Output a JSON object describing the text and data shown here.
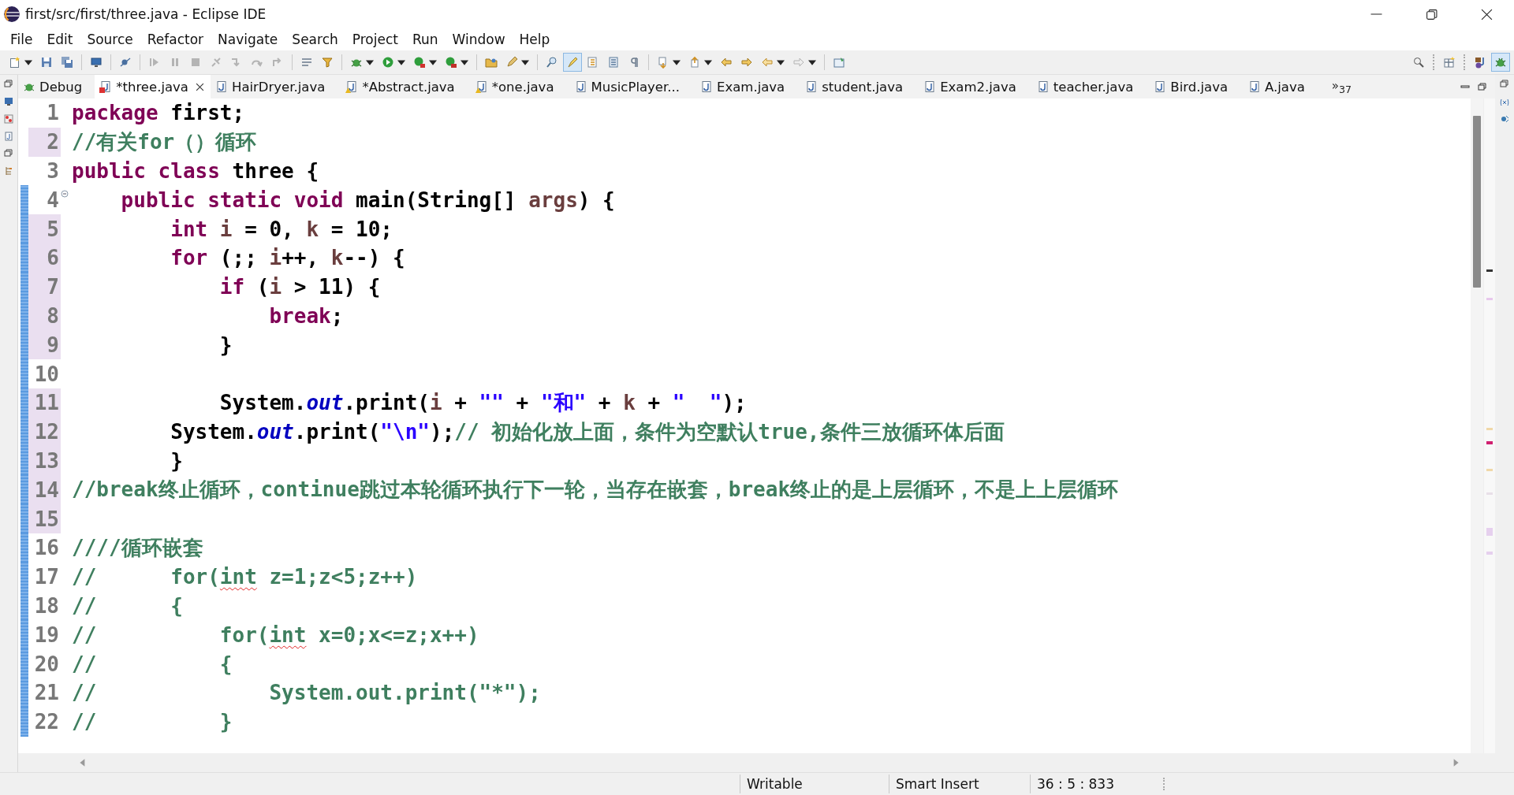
{
  "window": {
    "title": "first/src/first/three.java - Eclipse IDE"
  },
  "menu": [
    "File",
    "Edit",
    "Source",
    "Refactor",
    "Navigate",
    "Search",
    "Project",
    "Run",
    "Window",
    "Help"
  ],
  "perspective_tab": {
    "label": "Debug"
  },
  "tabs": [
    {
      "label": "*three.java",
      "selected": true,
      "error": true,
      "warning": false
    },
    {
      "label": "HairDryer.java",
      "selected": false,
      "error": false,
      "warning": false
    },
    {
      "label": "*Abstract.java",
      "selected": false,
      "error": false,
      "warning": true
    },
    {
      "label": "*one.java",
      "selected": false,
      "error": false,
      "warning": true
    },
    {
      "label": "MusicPlayer...",
      "selected": false,
      "error": false,
      "warning": false
    },
    {
      "label": "Exam.java",
      "selected": false,
      "error": false,
      "warning": false
    },
    {
      "label": "student.java",
      "selected": false,
      "error": false,
      "warning": false
    },
    {
      "label": "Exam2.java",
      "selected": false,
      "error": false,
      "warning": false
    },
    {
      "label": "teacher.java",
      "selected": false,
      "error": false,
      "warning": false
    },
    {
      "label": "Bird.java",
      "selected": false,
      "error": false,
      "warning": false
    },
    {
      "label": "A.java",
      "selected": false,
      "error": false,
      "warning": false
    }
  ],
  "tab_overflow": "»$_{37}$",
  "code_lines": [
    {
      "n": "1",
      "changed": false,
      "range": false,
      "fold": false,
      "tokens": [
        {
          "t": "package",
          "kind": "keyword"
        },
        {
          "t": " first;",
          "kind": "plain"
        }
      ]
    },
    {
      "n": "2",
      "changed": true,
      "range": false,
      "fold": false,
      "tokens": [
        {
          "t": "//有关for（）循环",
          "kind": "comment"
        }
      ]
    },
    {
      "n": "3",
      "changed": false,
      "range": false,
      "fold": false,
      "tokens": [
        {
          "t": "public class",
          "kind": "keyword"
        },
        {
          "t": " three {",
          "kind": "plain"
        }
      ]
    },
    {
      "n": "4",
      "changed": false,
      "range": true,
      "fold": true,
      "tokens": [
        {
          "t": "    public static void",
          "kind": "keyword"
        },
        {
          "t": " main(String[] ",
          "kind": "plain"
        },
        {
          "t": "args",
          "kind": "variable"
        },
        {
          "t": ") {",
          "kind": "plain"
        }
      ]
    },
    {
      "n": "5",
      "changed": true,
      "range": true,
      "fold": false,
      "tokens": [
        {
          "t": "        int ",
          "kind": "keyword"
        },
        {
          "t": "i",
          "kind": "variable"
        },
        {
          "t": " = 0, ",
          "kind": "plain"
        },
        {
          "t": "k",
          "kind": "variable"
        },
        {
          "t": " = 10;",
          "kind": "plain"
        }
      ]
    },
    {
      "n": "6",
      "changed": true,
      "range": true,
      "fold": false,
      "tokens": [
        {
          "t": "        for",
          "kind": "keyword"
        },
        {
          "t": " (;; ",
          "kind": "plain"
        },
        {
          "t": "i",
          "kind": "variable"
        },
        {
          "t": "++, ",
          "kind": "plain"
        },
        {
          "t": "k",
          "kind": "variable"
        },
        {
          "t": "--) {",
          "kind": "plain"
        }
      ]
    },
    {
      "n": "7",
      "changed": true,
      "range": true,
      "fold": false,
      "tokens": [
        {
          "t": "            if",
          "kind": "keyword"
        },
        {
          "t": " (",
          "kind": "plain"
        },
        {
          "t": "i",
          "kind": "variable"
        },
        {
          "t": " > 11) {",
          "kind": "plain"
        }
      ]
    },
    {
      "n": "8",
      "changed": true,
      "range": true,
      "fold": false,
      "tokens": [
        {
          "t": "                break",
          "kind": "keyword"
        },
        {
          "t": ";",
          "kind": "plain"
        }
      ]
    },
    {
      "n": "9",
      "changed": true,
      "range": true,
      "fold": false,
      "tokens": [
        {
          "t": "            }",
          "kind": "plain"
        }
      ]
    },
    {
      "n": "10",
      "changed": false,
      "range": true,
      "fold": false
    },
    {
      "n": "11",
      "changed": true,
      "range": true,
      "fold": false,
      "tokens": [
        {
          "t": "            System.",
          "kind": "plain"
        },
        {
          "t": "out",
          "kind": "field"
        },
        {
          "t": ".print(",
          "kind": "plain"
        },
        {
          "t": "i",
          "kind": "variable"
        },
        {
          "t": " + ",
          "kind": "plain"
        },
        {
          "t": "\"\"",
          "kind": "string"
        },
        {
          "t": " + ",
          "kind": "plain"
        },
        {
          "t": "\"和\"",
          "kind": "string"
        },
        {
          "t": " + ",
          "kind": "plain"
        },
        {
          "t": "k",
          "kind": "variable"
        },
        {
          "t": " + ",
          "kind": "plain"
        },
        {
          "t": "\"  \"",
          "kind": "string"
        },
        {
          "t": ");",
          "kind": "plain"
        }
      ]
    },
    {
      "n": "12",
      "changed": true,
      "range": true,
      "fold": false,
      "tokens": [
        {
          "t": "        System.",
          "kind": "plain"
        },
        {
          "t": "out",
          "kind": "field"
        },
        {
          "t": ".print(",
          "kind": "plain"
        },
        {
          "t": "\"\\n\"",
          "kind": "string"
        },
        {
          "t": ");",
          "kind": "plain"
        },
        {
          "t": "// 初始化放上面，条件为空默认true,条件三放循环体后面",
          "kind": "comment"
        }
      ]
    },
    {
      "n": "13",
      "changed": true,
      "range": true,
      "fold": false,
      "tokens": [
        {
          "t": "        }",
          "kind": "plain"
        }
      ]
    },
    {
      "n": "14",
      "changed": true,
      "range": true,
      "fold": false,
      "tokens": [
        {
          "t": "//break终止循环，continue跳过本轮循环执行下一轮，当存在嵌套，break终止的是上层循环，不是上上层循环",
          "kind": "comment"
        }
      ]
    },
    {
      "n": "15",
      "changed": true,
      "range": true,
      "fold": false
    },
    {
      "n": "16",
      "changed": false,
      "range": true,
      "fold": false,
      "tokens": [
        {
          "t": "////循环嵌套",
          "kind": "comment"
        }
      ]
    },
    {
      "n": "17",
      "changed": false,
      "range": true,
      "fold": false,
      "tokens": [
        {
          "t": "//      for(",
          "kind": "comment"
        },
        {
          "t": "int",
          "kind": "flagged"
        },
        {
          "t": " z=1;z<5;z++)",
          "kind": "comment"
        }
      ]
    },
    {
      "n": "18",
      "changed": false,
      "range": true,
      "fold": false,
      "tokens": [
        {
          "t": "//      {",
          "kind": "comment"
        }
      ]
    },
    {
      "n": "19",
      "changed": false,
      "range": true,
      "fold": false,
      "tokens": [
        {
          "t": "//          for(",
          "kind": "comment"
        },
        {
          "t": "int",
          "kind": "flagged"
        },
        {
          "t": " x=0;x<=z;x++)",
          "kind": "comment"
        }
      ]
    },
    {
      "n": "20",
      "changed": false,
      "range": true,
      "fold": false,
      "tokens": [
        {
          "t": "//          {",
          "kind": "comment"
        }
      ]
    },
    {
      "n": "21",
      "changed": false,
      "range": true,
      "fold": false,
      "tokens": [
        {
          "t": "//              System.out.print(\"*\");",
          "kind": "comment"
        }
      ]
    },
    {
      "n": "22",
      "changed": false,
      "range": true,
      "fold": false,
      "tokens": [
        {
          "t": "//          }",
          "kind": "comment"
        }
      ]
    }
  ],
  "status_bar": [
    "Writable",
    "Smart Insert",
    "36 : 5 : 833"
  ]
}
